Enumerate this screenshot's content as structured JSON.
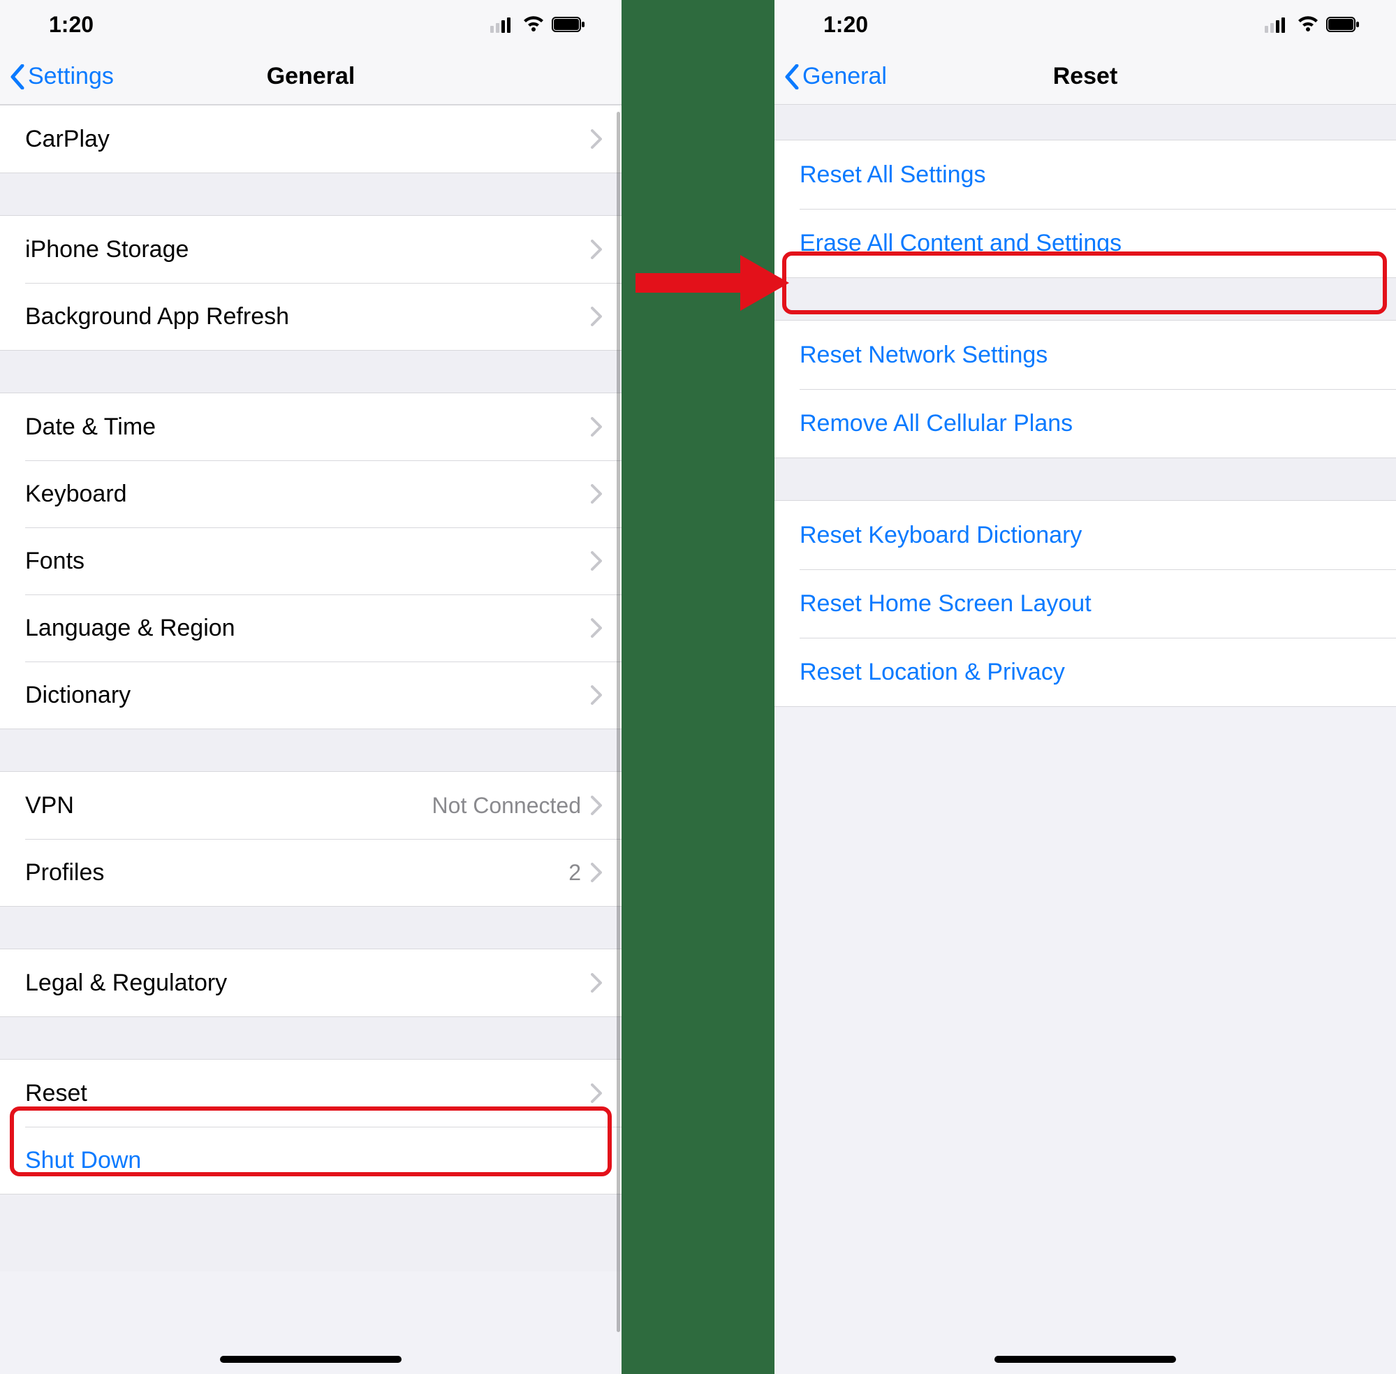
{
  "status": {
    "time": "1:20"
  },
  "left": {
    "nav": {
      "back": "Settings",
      "title": "General"
    },
    "groups": [
      {
        "rows": [
          {
            "label": "CarPlay",
            "value": "",
            "chevron": true
          }
        ]
      },
      {
        "rows": [
          {
            "label": "iPhone Storage",
            "value": "",
            "chevron": true
          },
          {
            "label": "Background App Refresh",
            "value": "",
            "chevron": true
          }
        ]
      },
      {
        "rows": [
          {
            "label": "Date & Time",
            "value": "",
            "chevron": true
          },
          {
            "label": "Keyboard",
            "value": "",
            "chevron": true
          },
          {
            "label": "Fonts",
            "value": "",
            "chevron": true
          },
          {
            "label": "Language & Region",
            "value": "",
            "chevron": true
          },
          {
            "label": "Dictionary",
            "value": "",
            "chevron": true
          }
        ]
      },
      {
        "rows": [
          {
            "label": "VPN",
            "value": "Not Connected",
            "chevron": true
          },
          {
            "label": "Profiles",
            "value": "2",
            "chevron": true
          }
        ]
      },
      {
        "rows": [
          {
            "label": "Legal & Regulatory",
            "value": "",
            "chevron": true
          }
        ]
      },
      {
        "rows": [
          {
            "label": "Reset",
            "value": "",
            "chevron": true
          },
          {
            "label": "Shut Down",
            "value": "",
            "chevron": false,
            "blue": true
          }
        ]
      }
    ]
  },
  "right": {
    "nav": {
      "back": "General",
      "title": "Reset"
    },
    "groups": [
      {
        "rows": [
          {
            "label": "Reset All Settings"
          },
          {
            "label": "Erase All Content and Settings"
          }
        ]
      },
      {
        "rows": [
          {
            "label": "Reset Network Settings"
          },
          {
            "label": "Remove All Cellular Plans"
          }
        ]
      },
      {
        "rows": [
          {
            "label": "Reset Keyboard Dictionary"
          },
          {
            "label": "Reset Home Screen Layout"
          },
          {
            "label": "Reset Location & Privacy"
          }
        ]
      }
    ]
  },
  "annotation": {
    "highlight_left": "Reset",
    "highlight_right": "Erase All Content and Settings"
  }
}
